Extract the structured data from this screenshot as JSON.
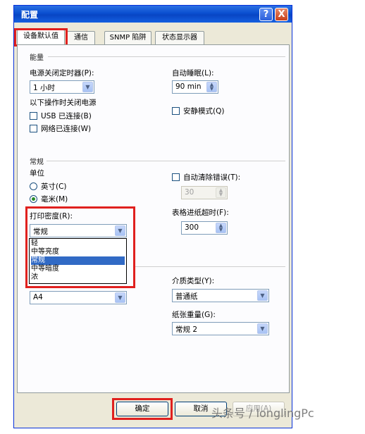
{
  "window": {
    "title": "配置",
    "help_glyph": "?",
    "close_glyph": "X"
  },
  "tabs": [
    {
      "label": "设备默认值",
      "active": true
    },
    {
      "label": "通信"
    },
    {
      "label": "SNMP 陷阱"
    },
    {
      "label": "状态显示器"
    }
  ],
  "energy": {
    "group": "能量",
    "power_off_label": "电源关闭定时器(P):",
    "power_off_value": "1 小时",
    "sleep_label": "自动睡眠(L):",
    "sleep_value": "90 min",
    "off_when_label": "以下操作时关闭电源",
    "usb_label": "USB 已连接(B)",
    "usb_checked": false,
    "network_label": "网络已连接(W)",
    "network_checked": false,
    "quiet_label": "安静模式(Q)",
    "quiet_checked": false
  },
  "general": {
    "group": "常规",
    "unit_label": "单位",
    "unit_inch": "英寸(C)",
    "unit_mm": "毫米(M)",
    "unit_selected": "mm",
    "auto_clear_label": "自动清除错误(T):",
    "auto_clear_checked": false,
    "auto_clear_value": "30",
    "density_label": "打印密度(R):",
    "density_value": "常规",
    "density_options": [
      "轻",
      "中等亮度",
      "常规",
      "中等暗度",
      "浓"
    ],
    "density_selected_index": 2,
    "form_feed_label": "表格进纸超时(F):",
    "form_feed_value": "300"
  },
  "paper": {
    "size_value": "A4",
    "media_label": "介质类型(Y):",
    "media_value": "普通纸",
    "weight_label": "纸张重量(G):",
    "weight_value": "常规 2"
  },
  "buttons": {
    "ok": "确定",
    "cancel": "取消",
    "apply": "应用(A)"
  },
  "watermark": "头条号 / longlingPc",
  "colors": {
    "highlight": "#e0201e",
    "selection": "#316ac5",
    "titlebar": "#0a4fd0"
  }
}
